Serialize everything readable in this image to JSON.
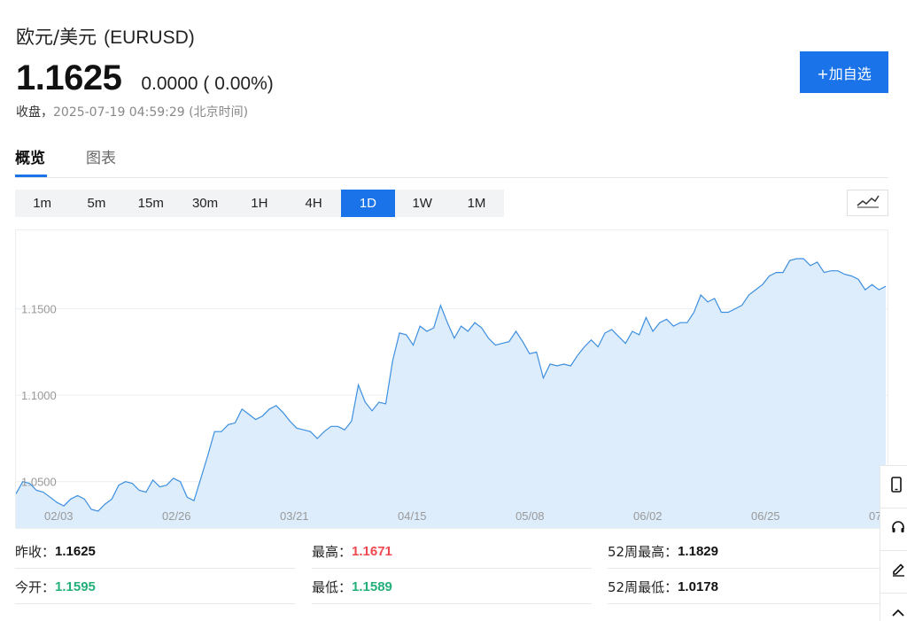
{
  "header": {
    "title": "欧元/美元",
    "code": "(EURUSD)",
    "price": "1.1625",
    "change": "0.0000 ( 0.00%)",
    "status_label": "收盘，",
    "timestamp": "2025-07-19 04:59:29",
    "timezone": "(北京时间)"
  },
  "watchlist_button": "+加自选",
  "tabs": [
    {
      "label": "概览",
      "active": true
    },
    {
      "label": "图表",
      "active": false
    }
  ],
  "periods": [
    "1m",
    "5m",
    "15m",
    "30m",
    "1H",
    "4H",
    "1D",
    "1W",
    "1M"
  ],
  "active_period": "1D",
  "chart_type_icon": "line-chart-icon",
  "colors": {
    "accent": "#1a73e8",
    "line": "#3d8fe0",
    "fill": "#deedfb",
    "up": "#f0484f",
    "down": "#23b07a"
  },
  "stats": {
    "prev_close": {
      "label": "昨收：",
      "value": "1.1625"
    },
    "open": {
      "label": "今开：",
      "value": "1.1595"
    },
    "high": {
      "label": "最高：",
      "value": "1.1671"
    },
    "low": {
      "label": "最低：",
      "value": "1.1589"
    },
    "week52_high": {
      "label": "52周最高：",
      "value": "1.1829"
    },
    "week52_low": {
      "label": "52周最低：",
      "value": "1.0178"
    }
  },
  "side_tools": [
    "phone-icon",
    "headset-icon",
    "edit-icon",
    "chevron-up-icon"
  ],
  "chart_data": {
    "type": "area",
    "x_ticks": [
      "02/03",
      "02/26",
      "03/21",
      "04/15",
      "05/08",
      "06/02",
      "06/25",
      "07"
    ],
    "y_ticks": [
      "1.0500",
      "1.1000",
      "1.1500"
    ],
    "ylim": [
      1.0222,
      1.1954
    ],
    "grid": true,
    "values": [
      1.043,
      1.05,
      1.049,
      1.045,
      1.044,
      1.041,
      1.038,
      1.036,
      1.04,
      1.042,
      1.04,
      1.034,
      1.033,
      1.037,
      1.04,
      1.048,
      1.05,
      1.049,
      1.045,
      1.044,
      1.051,
      1.047,
      1.048,
      1.052,
      1.05,
      1.041,
      1.039,
      1.052,
      1.065,
      1.079,
      1.079,
      1.083,
      1.084,
      1.092,
      1.089,
      1.086,
      1.088,
      1.092,
      1.094,
      1.09,
      1.085,
      1.081,
      1.08,
      1.079,
      1.075,
      1.079,
      1.082,
      1.082,
      1.08,
      1.085,
      1.106,
      1.096,
      1.091,
      1.096,
      1.095,
      1.12,
      1.136,
      1.135,
      1.129,
      1.14,
      1.137,
      1.139,
      1.152,
      1.142,
      1.133,
      1.14,
      1.137,
      1.142,
      1.139,
      1.133,
      1.129,
      1.13,
      1.131,
      1.137,
      1.131,
      1.124,
      1.125,
      1.11,
      1.118,
      1.117,
      1.118,
      1.117,
      1.123,
      1.128,
      1.132,
      1.128,
      1.136,
      1.138,
      1.134,
      1.13,
      1.137,
      1.135,
      1.145,
      1.137,
      1.142,
      1.144,
      1.14,
      1.142,
      1.142,
      1.148,
      1.158,
      1.154,
      1.156,
      1.148,
      1.148,
      1.15,
      1.152,
      1.158,
      1.161,
      1.164,
      1.169,
      1.171,
      1.171,
      1.178,
      1.179,
      1.179,
      1.175,
      1.177,
      1.171,
      1.172,
      1.172,
      1.17,
      1.169,
      1.167,
      1.161,
      1.164,
      1.161,
      1.163
    ]
  }
}
